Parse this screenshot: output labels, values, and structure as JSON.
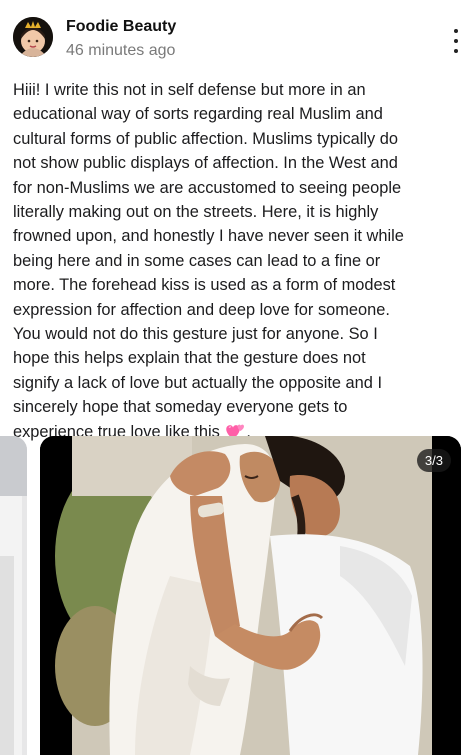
{
  "post": {
    "author": "Foodie Beauty",
    "time": "46 minutes ago",
    "body_lines": [
      "Hiii! I write this not in self defense but more in an",
      "educational way of sorts regarding real Muslim and",
      "cultural forms of public affection. Muslims typically do",
      "not show public displays of affection. In the West and",
      "for non-Muslims we are accustomed to seeing people",
      "literally making out on the streets. Here, it is highly",
      "frowned upon, and honestly I have never seen it while",
      "being here and in some cases can lead to a fine or",
      "more. The forehead kiss is used as a form of modest",
      "expression for affection and deep love for someone.",
      "You would not do this gesture just for anyone. So I",
      "hope this helps explain that the gesture does not",
      "signify a lack of love but actually the opposite and I",
      "sincerely hope that someday everyone gets to"
    ],
    "last_line_text": "experience true love like this",
    "last_line_end": ".",
    "emoji_icon": "two-hearts-emoji"
  },
  "media": {
    "counter": "3/3",
    "current_index": 3,
    "total": 3
  },
  "icons": {
    "more": "more-vertical-icon",
    "avatar": "avatar-image"
  },
  "colors": {
    "author_text": "#111111",
    "meta_text": "#7a7a7a",
    "body_text": "#1c1c1e",
    "counter_bg": "#191919",
    "emoji_pink": "#ff5fa8"
  }
}
